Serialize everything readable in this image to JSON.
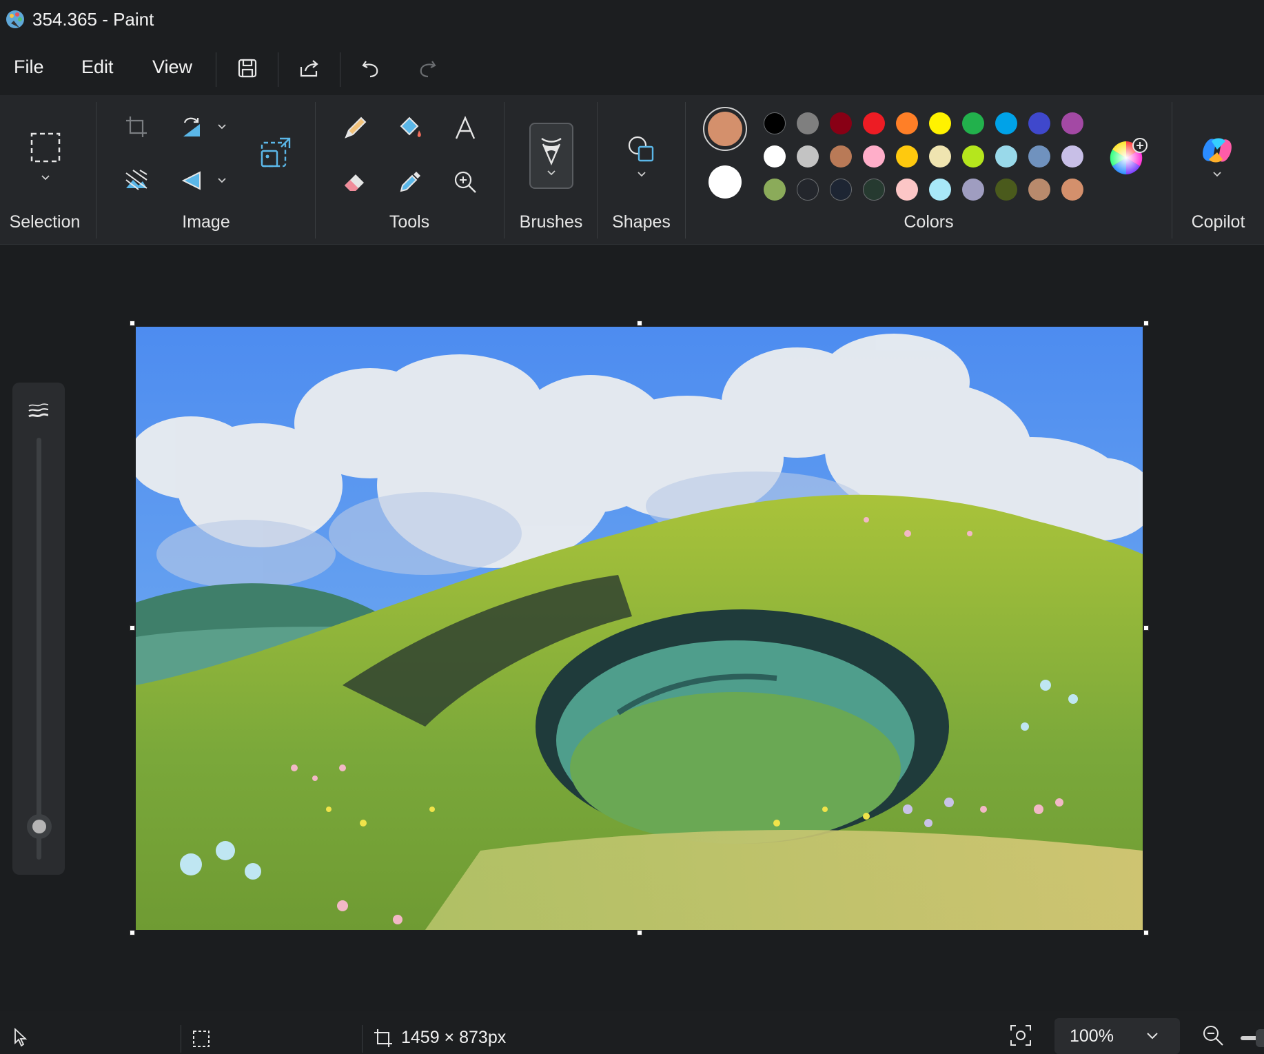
{
  "window": {
    "title": "354.365 - Paint"
  },
  "menu": {
    "file": "File",
    "edit": "Edit",
    "view": "View"
  },
  "ribbon": {
    "groups": {
      "selection": "Selection",
      "image": "Image",
      "tools": "Tools",
      "brushes": "Brushes",
      "shapes": "Shapes",
      "colors": "Colors",
      "copilot": "Copilot"
    },
    "primary_color": "#d4906c",
    "secondary_color": "#ffffff",
    "palette": [
      [
        "#000000",
        "#7f7f7f",
        "#880015",
        "#ed1c24",
        "#ff7f27",
        "#fff200",
        "#22b14c",
        "#00a2e8",
        "#3f48cc",
        "#a349a4"
      ],
      [
        "#ffffff",
        "#c3c3c3",
        "#b97a57",
        "#ffaec9",
        "#ffc90e",
        "#efe4b0",
        "#b5e61d",
        "#99d9ea",
        "#7092be",
        "#c8bfe7"
      ],
      [
        "#8bab5a",
        "#23262c",
        "#1d2533",
        "#263a30",
        "#fcc6c6",
        "#a8e8f8",
        "#9f9dc0",
        "#4a5a1c",
        "#b98a6c",
        "#d4906c"
      ]
    ]
  },
  "canvas": {
    "image": "green hills landscape with rock arch and clouds"
  },
  "status": {
    "dimensions": "1459 × 873px",
    "zoom": "100%"
  }
}
